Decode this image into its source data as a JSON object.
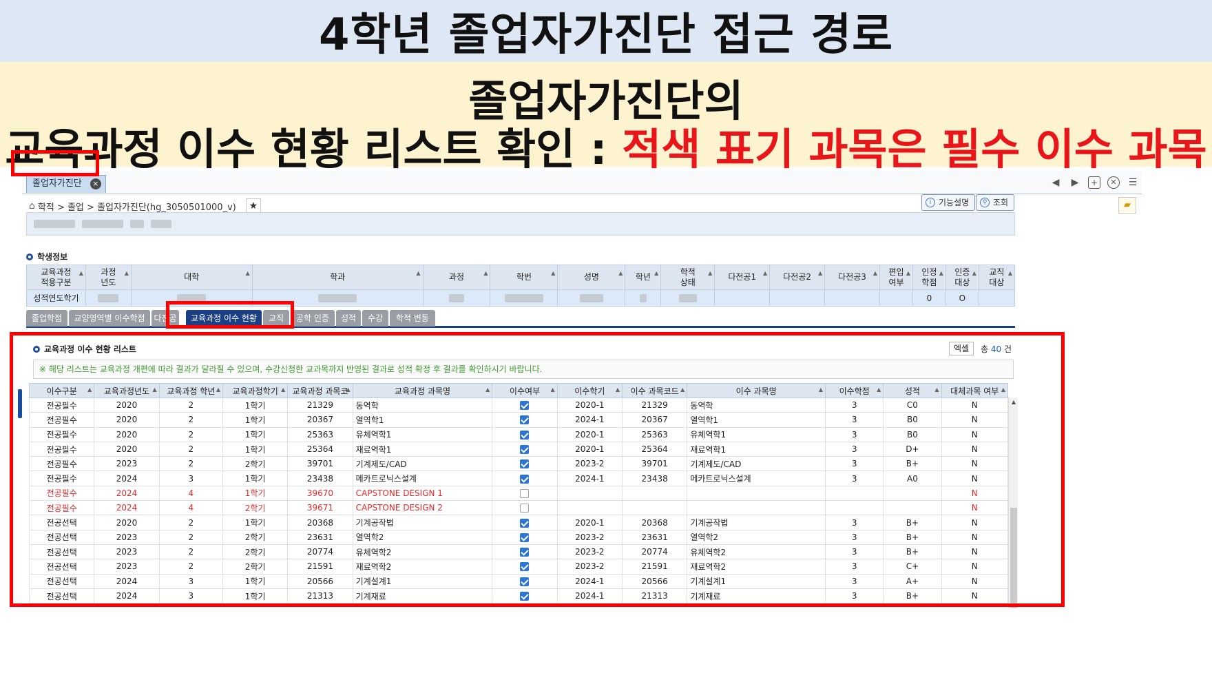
{
  "banner": {
    "title": "4학년 졸업자가진단 접근 경로",
    "line1": "졸업자가진단의",
    "line2_black": "교육과정 이수 현황 리스트 확인 : ",
    "line2_red": "적색 표기 과목은 필수 이수 과목"
  },
  "doc_tab": {
    "label": "졸업자가진단",
    "close": "×"
  },
  "tab_controls": [
    "◀",
    "▶",
    "+",
    "✕",
    "☰"
  ],
  "breadcrumb": {
    "home_icon": "home-icon",
    "path": "학적 > 졸업 > 졸업자가진단(hg_3050501000_v)",
    "star": "★"
  },
  "toolbar": {
    "help_label": "기능설명",
    "search_label": "조회"
  },
  "student_section": {
    "title": "학생정보",
    "headers": [
      "교육과정\n적용구분",
      "과정\n년도",
      "대학",
      "학과",
      "과정",
      "학번",
      "성명",
      "학년",
      "학적\n상태",
      "다전공1",
      "다전공2",
      "다전공3",
      "편입\n여부",
      "인정\n학점",
      "인증\n대상",
      "교직\n대상"
    ],
    "row": [
      "성적연도학기",
      "",
      "",
      "",
      "",
      "",
      "",
      "",
      "",
      "",
      "",
      "",
      "",
      "0",
      "O",
      ""
    ]
  },
  "sub_tabs": [
    {
      "label": "졸업학점"
    },
    {
      "label": "교양영역별 이수학점"
    },
    {
      "label": "다전공"
    },
    {
      "label": "교육과정 이수 현황",
      "active": true
    },
    {
      "label": "교직"
    },
    {
      "label": "공학 인증"
    },
    {
      "label": "성적"
    },
    {
      "label": "수강"
    },
    {
      "label": "학적 변동"
    }
  ],
  "list": {
    "title": "교육과정 이수 현황 리스트",
    "excel_label": "엑셀",
    "count_prefix": "총",
    "count": "40",
    "count_suffix": "건",
    "notice": "※ 해당 리스트는 교육과정 개편에 따라 결과가 달라질 수 있으며, 수강신청한 교과목까지 반영된 결과로 성적 확정 후 결과를 확인하시기 바랍니다.",
    "headers": [
      "이수구분",
      "교육과정년도",
      "교육과정 학년",
      "교육과정학기",
      "교육과정 과목코",
      "교육과정 과목명",
      "이수여부",
      "이수학기",
      "이수 과목코드",
      "이수 과목명",
      "이수학점",
      "성적",
      "대체과목 여부"
    ],
    "rows": [
      {
        "type": "전공필수",
        "year": "2020",
        "grade": "2",
        "sem": "1학기",
        "code": "21329",
        "name": "동역학",
        "done": true,
        "dsem": "2020-1",
        "dcode": "21329",
        "dname": "동역학",
        "credit": "3",
        "score": "C0",
        "alt": "N",
        "required": false
      },
      {
        "type": "전공필수",
        "year": "2020",
        "grade": "2",
        "sem": "1학기",
        "code": "20367",
        "name": "열역학1",
        "done": true,
        "dsem": "2024-1",
        "dcode": "20367",
        "dname": "열역학1",
        "credit": "3",
        "score": "B0",
        "alt": "N",
        "required": false
      },
      {
        "type": "전공필수",
        "year": "2020",
        "grade": "2",
        "sem": "1학기",
        "code": "25363",
        "name": "유체역학1",
        "done": true,
        "dsem": "2020-1",
        "dcode": "25363",
        "dname": "유체역학1",
        "credit": "3",
        "score": "B0",
        "alt": "N",
        "required": false
      },
      {
        "type": "전공필수",
        "year": "2020",
        "grade": "2",
        "sem": "1학기",
        "code": "25364",
        "name": "재료역학1",
        "done": true,
        "dsem": "2020-1",
        "dcode": "25364",
        "dname": "재료역학1",
        "credit": "3",
        "score": "D+",
        "alt": "N",
        "required": false
      },
      {
        "type": "전공필수",
        "year": "2023",
        "grade": "2",
        "sem": "2학기",
        "code": "39701",
        "name": "기계제도/CAD",
        "done": true,
        "dsem": "2023-2",
        "dcode": "39701",
        "dname": "기계제도/CAD",
        "credit": "3",
        "score": "B+",
        "alt": "N",
        "required": false
      },
      {
        "type": "전공필수",
        "year": "2024",
        "grade": "3",
        "sem": "1학기",
        "code": "23438",
        "name": "메카트로닉스설계",
        "done": true,
        "dsem": "2024-1",
        "dcode": "23438",
        "dname": "메카트로닉스설계",
        "credit": "3",
        "score": "A0",
        "alt": "N",
        "required": false
      },
      {
        "type": "전공필수",
        "year": "2024",
        "grade": "4",
        "sem": "1학기",
        "code": "39670",
        "name": "CAPSTONE DESIGN 1",
        "done": false,
        "dsem": "",
        "dcode": "",
        "dname": "",
        "credit": "",
        "score": "",
        "alt": "N",
        "required": true
      },
      {
        "type": "전공필수",
        "year": "2024",
        "grade": "4",
        "sem": "2학기",
        "code": "39671",
        "name": "CAPSTONE DESIGN 2",
        "done": false,
        "dsem": "",
        "dcode": "",
        "dname": "",
        "credit": "",
        "score": "",
        "alt": "N",
        "required": true
      },
      {
        "type": "전공선택",
        "year": "2020",
        "grade": "2",
        "sem": "1학기",
        "code": "20368",
        "name": "기계공작법",
        "done": true,
        "dsem": "2020-1",
        "dcode": "20368",
        "dname": "기계공작법",
        "credit": "3",
        "score": "B+",
        "alt": "N",
        "required": false
      },
      {
        "type": "전공선택",
        "year": "2023",
        "grade": "2",
        "sem": "2학기",
        "code": "23631",
        "name": "열역학2",
        "done": true,
        "dsem": "2023-2",
        "dcode": "23631",
        "dname": "열역학2",
        "credit": "3",
        "score": "B+",
        "alt": "N",
        "required": false
      },
      {
        "type": "전공선택",
        "year": "2023",
        "grade": "2",
        "sem": "2학기",
        "code": "20774",
        "name": "유체역학2",
        "done": true,
        "dsem": "2023-2",
        "dcode": "20774",
        "dname": "유체역학2",
        "credit": "3",
        "score": "B+",
        "alt": "N",
        "required": false
      },
      {
        "type": "전공선택",
        "year": "2023",
        "grade": "2",
        "sem": "2학기",
        "code": "21591",
        "name": "재료역학2",
        "done": true,
        "dsem": "2023-2",
        "dcode": "21591",
        "dname": "재료역학2",
        "credit": "3",
        "score": "C+",
        "alt": "N",
        "required": false
      },
      {
        "type": "전공선택",
        "year": "2024",
        "grade": "3",
        "sem": "1학기",
        "code": "20566",
        "name": "기계설계1",
        "done": true,
        "dsem": "2024-1",
        "dcode": "20566",
        "dname": "기계설계1",
        "credit": "3",
        "score": "A+",
        "alt": "N",
        "required": false
      },
      {
        "type": "전공선택",
        "year": "2024",
        "grade": "3",
        "sem": "1학기",
        "code": "21313",
        "name": "기계재료",
        "done": true,
        "dsem": "2024-1",
        "dcode": "21313",
        "dname": "기계재료",
        "credit": "3",
        "score": "B+",
        "alt": "N",
        "required": false
      }
    ]
  },
  "colors": {
    "highlight": "#ff0000",
    "required_text": "#e32a2a",
    "active_tab": "#1b3f85"
  }
}
